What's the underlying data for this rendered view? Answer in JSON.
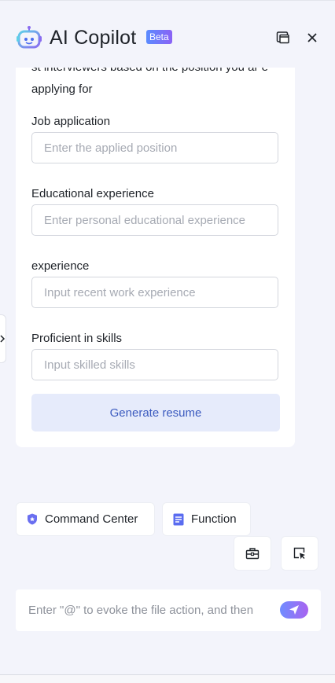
{
  "header": {
    "title": "AI Copilot",
    "badge": "Beta",
    "logo_icon": "robot-logo-icon",
    "window_icon": "new-window-icon",
    "close_icon": "close-icon"
  },
  "form": {
    "intro_text": "st interviewers based on the position you ar e applying for",
    "fields": [
      {
        "label": "Job application",
        "placeholder": "Enter the applied position",
        "value": ""
      },
      {
        "label": "Educational experience",
        "placeholder": "Enter personal educational experience",
        "value": ""
      },
      {
        "label": "experience",
        "placeholder": "Input recent work experience",
        "value": ""
      },
      {
        "label": "Proficient in skills",
        "placeholder": "Input skilled skills",
        "value": ""
      }
    ],
    "generate_label": "Generate resume"
  },
  "chips": {
    "command_center": "Command Center",
    "function": "Function"
  },
  "tools": {
    "toolbox_icon": "toolbox-icon",
    "select_icon": "pointer-select-icon"
  },
  "chat": {
    "placeholder": "Enter \"@\" to evoke the file action, and then",
    "value": "",
    "send_icon": "send-icon"
  },
  "colors": {
    "accent": "#3c5bbf",
    "button_bg": "#e6ebfb",
    "page_bg": "#f3f4fb",
    "gradient_start": "#6f8cff",
    "gradient_end": "#a863f0"
  }
}
